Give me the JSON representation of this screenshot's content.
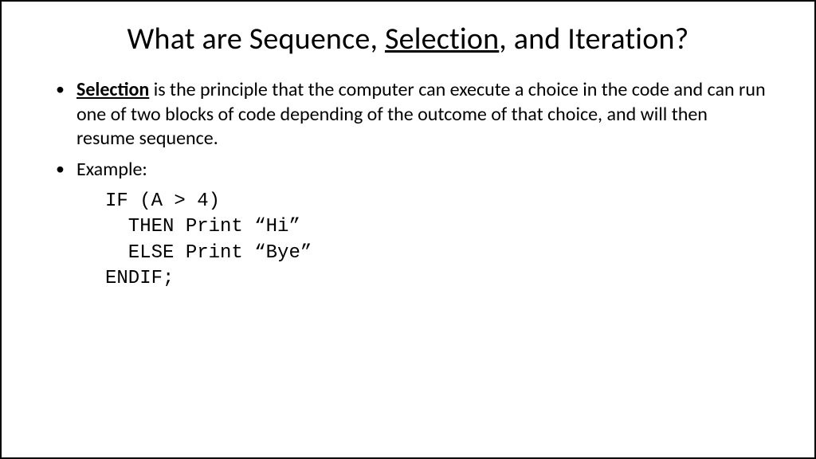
{
  "title": {
    "part1": "What are Sequence, ",
    "underlined": "Selection",
    "part3": ", and Iteration?"
  },
  "bullets": [
    {
      "bold_underline": "Selection",
      "rest": " is the principle that the computer can execute a choice in the code and can run one of two blocks of code depending of the outcome of that choice, and will then resume sequence."
    },
    {
      "text": "Example:"
    }
  ],
  "code": {
    "line1": "IF (A > 4)",
    "line2": "  THEN Print “Hi”",
    "line3": "  ELSE Print “Bye”",
    "line4": "ENDIF;"
  }
}
